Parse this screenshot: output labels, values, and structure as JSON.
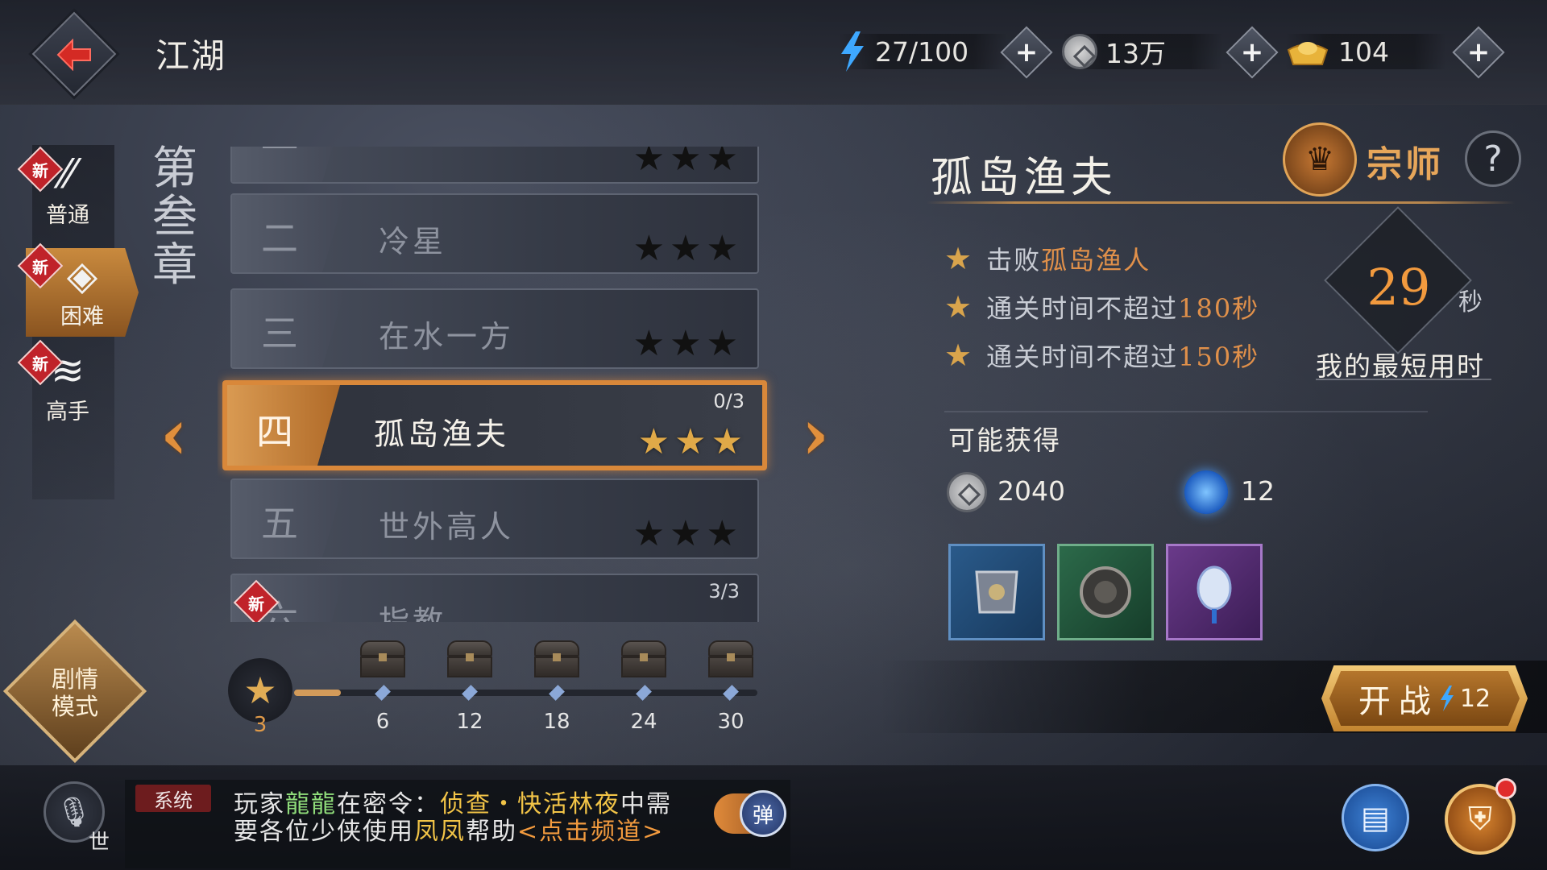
{
  "header": {
    "title": "江湖",
    "stamina": "27/100",
    "coins": "13万",
    "gold": "104"
  },
  "difficulty_tabs": [
    {
      "label": "普通",
      "icon": "sword-icon",
      "badge": "新",
      "active": false
    },
    {
      "label": "困难",
      "icon": "shield-icon",
      "badge": "新",
      "active": true
    },
    {
      "label": "高手",
      "icon": "dragon-icon",
      "badge": "新",
      "active": false
    }
  ],
  "chapter": {
    "title": "第叁章"
  },
  "stages": [
    {
      "num": "一",
      "name": "",
      "stars": "★★★",
      "progress": ""
    },
    {
      "num": "二",
      "name": "冷星",
      "stars": "★★★",
      "progress": ""
    },
    {
      "num": "三",
      "name": "在水一方",
      "stars": "★★★",
      "progress": ""
    },
    {
      "num": "四",
      "name": "孤岛渔夫",
      "stars": "★★★",
      "progress": "0/3"
    },
    {
      "num": "五",
      "name": "世外高人",
      "stars": "★★★",
      "progress": ""
    },
    {
      "num": "六",
      "name": "指教",
      "stars": "",
      "progress": "3/3",
      "badge": "新"
    }
  ],
  "star_progress": {
    "current": "3",
    "fill_fraction": 0.1,
    "milestones": [
      "6",
      "12",
      "18",
      "24",
      "30"
    ]
  },
  "story_mode": {
    "line1": "剧情",
    "line2": "模式"
  },
  "detail": {
    "title": "孤岛渔夫",
    "rank": "宗师",
    "help": "?",
    "objectives": {
      "o1_prefix": "击败",
      "o1_target": "孤岛渔人",
      "o2_prefix": "通关时间不超过",
      "o2_value": "180秒",
      "o3_prefix": "通关时间不超过",
      "o3_value": "150秒"
    },
    "best_time": "29",
    "best_unit": "秒",
    "best_label": "我的最短用时",
    "reward_heading": "可能获得",
    "reward_coins": "2040",
    "reward_jade": "12",
    "items": [
      "armor-fragment-icon",
      "shield-fragment-icon",
      "lantern-ornament-icon"
    ],
    "battle_label": "开战",
    "battle_cost": "12"
  },
  "chat": {
    "channel": "世",
    "system_tag": "系统",
    "l1_a": "玩家",
    "l1_player": "龍龍",
    "l1_b": "在密令：",
    "l1_task": "侦查・快活林夜",
    "l1_c": "中需",
    "l2_a": "要各位少侠使用",
    "l2_player": "凤凤",
    "l2_b": "帮助",
    "l2_link": "<点击频道>",
    "toggle_label": "弹"
  },
  "colors": {
    "accent": "#d9883a",
    "gold_star": "#e0a948",
    "highlight": "#e0904a"
  }
}
